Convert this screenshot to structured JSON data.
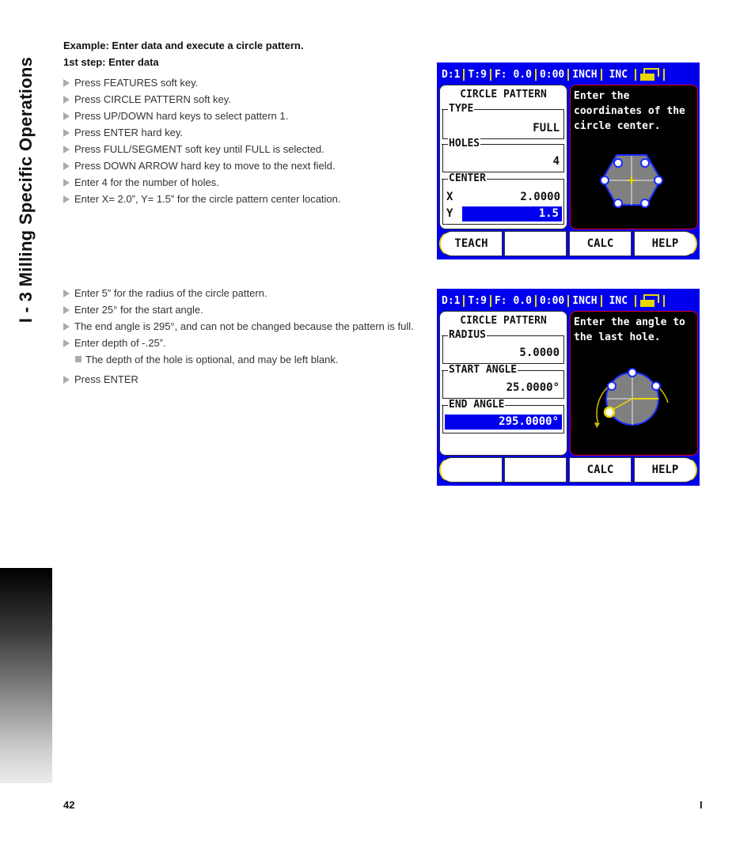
{
  "side_tab": {
    "title": "I - 3 Milling Specific Operations"
  },
  "example": {
    "title": "Example:  Enter data and execute a circle pattern.",
    "step_title": "1st step: Enter data",
    "steps_part1": [
      "Press FEATURES soft key.",
      "Press CIRCLE PATTERN soft key.",
      "Press UP/DOWN hard keys to select pattern 1.",
      "Press ENTER hard key.",
      "Press FULL/SEGMENT soft key until FULL is selected.",
      "Press DOWN ARROW hard key to move to the next field.",
      "Enter 4 for the number of holes.",
      "Enter X= 2.0”, Y= 1.5” for the circle pattern center location."
    ],
    "steps_part2": [
      "Enter 5” for the radius of the circle pattern.",
      "Enter 25° for the start angle.",
      "The end angle is 295°, and can not be changed because the pattern is full.",
      "Enter depth of -.25”."
    ],
    "note": "The depth of the hole is optional, and may be left blank.",
    "final_step": "Press ENTER"
  },
  "screen1": {
    "status": {
      "datum": "D:1",
      "tool": "T:9",
      "feed": "F:  0.0",
      "timer": "0:00",
      "units": "INCH",
      "mode": "INC",
      "icon": "window-switch-icon"
    },
    "form_title": "CIRCLE PATTERN",
    "type_label": "TYPE",
    "type_value": "FULL",
    "holes_label": "HOLES",
    "holes_value": "4",
    "center_label": "CENTER",
    "x_label": "X",
    "x_value": "2.0000",
    "y_label": "Y",
    "y_value": "1.5",
    "help_text": "Enter the coordinates of the circle center.",
    "softkeys": [
      "TEACH",
      "",
      "CALC",
      "HELP"
    ]
  },
  "screen2": {
    "status": {
      "datum": "D:1",
      "tool": "T:9",
      "feed": "F:  0.0",
      "timer": "0:00",
      "units": "INCH",
      "mode": "INC",
      "icon": "window-switch-icon"
    },
    "form_title": "CIRCLE PATTERN",
    "radius_label": "RADIUS",
    "radius_value": "5.0000",
    "start_label": "START ANGLE",
    "start_value": "25.0000°",
    "end_label": "END ANGLE",
    "end_value": "295.0000°",
    "help_text": "Enter the angle to the last hole.",
    "softkeys": [
      "",
      "",
      "CALC",
      "HELP"
    ]
  },
  "colors": {
    "screen_bg": "#0000ee",
    "accent_yellow": "#e8d800",
    "help_border": "#e00020",
    "hole_blue": "#1a2cff",
    "circle_gray": "#808080"
  },
  "footer": {
    "page_number": "42",
    "section": "I"
  }
}
